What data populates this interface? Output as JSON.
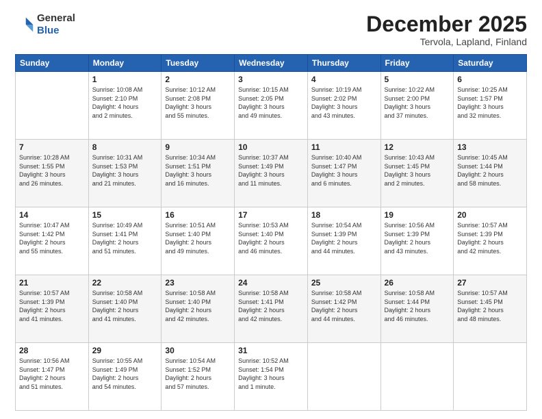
{
  "logo": {
    "general": "General",
    "blue": "Blue"
  },
  "header": {
    "month": "December 2025",
    "location": "Tervola, Lapland, Finland"
  },
  "weekdays": [
    "Sunday",
    "Monday",
    "Tuesday",
    "Wednesday",
    "Thursday",
    "Friday",
    "Saturday"
  ],
  "weeks": [
    [
      {
        "day": "",
        "info": ""
      },
      {
        "day": "1",
        "info": "Sunrise: 10:08 AM\nSunset: 2:10 PM\nDaylight: 4 hours\nand 2 minutes."
      },
      {
        "day": "2",
        "info": "Sunrise: 10:12 AM\nSunset: 2:08 PM\nDaylight: 3 hours\nand 55 minutes."
      },
      {
        "day": "3",
        "info": "Sunrise: 10:15 AM\nSunset: 2:05 PM\nDaylight: 3 hours\nand 49 minutes."
      },
      {
        "day": "4",
        "info": "Sunrise: 10:19 AM\nSunset: 2:02 PM\nDaylight: 3 hours\nand 43 minutes."
      },
      {
        "day": "5",
        "info": "Sunrise: 10:22 AM\nSunset: 2:00 PM\nDaylight: 3 hours\nand 37 minutes."
      },
      {
        "day": "6",
        "info": "Sunrise: 10:25 AM\nSunset: 1:57 PM\nDaylight: 3 hours\nand 32 minutes."
      }
    ],
    [
      {
        "day": "7",
        "info": "Sunrise: 10:28 AM\nSunset: 1:55 PM\nDaylight: 3 hours\nand 26 minutes."
      },
      {
        "day": "8",
        "info": "Sunrise: 10:31 AM\nSunset: 1:53 PM\nDaylight: 3 hours\nand 21 minutes."
      },
      {
        "day": "9",
        "info": "Sunrise: 10:34 AM\nSunset: 1:51 PM\nDaylight: 3 hours\nand 16 minutes."
      },
      {
        "day": "10",
        "info": "Sunrise: 10:37 AM\nSunset: 1:49 PM\nDaylight: 3 hours\nand 11 minutes."
      },
      {
        "day": "11",
        "info": "Sunrise: 10:40 AM\nSunset: 1:47 PM\nDaylight: 3 hours\nand 6 minutes."
      },
      {
        "day": "12",
        "info": "Sunrise: 10:43 AM\nSunset: 1:45 PM\nDaylight: 3 hours\nand 2 minutes."
      },
      {
        "day": "13",
        "info": "Sunrise: 10:45 AM\nSunset: 1:44 PM\nDaylight: 2 hours\nand 58 minutes."
      }
    ],
    [
      {
        "day": "14",
        "info": "Sunrise: 10:47 AM\nSunset: 1:42 PM\nDaylight: 2 hours\nand 55 minutes."
      },
      {
        "day": "15",
        "info": "Sunrise: 10:49 AM\nSunset: 1:41 PM\nDaylight: 2 hours\nand 51 minutes."
      },
      {
        "day": "16",
        "info": "Sunrise: 10:51 AM\nSunset: 1:40 PM\nDaylight: 2 hours\nand 49 minutes."
      },
      {
        "day": "17",
        "info": "Sunrise: 10:53 AM\nSunset: 1:40 PM\nDaylight: 2 hours\nand 46 minutes."
      },
      {
        "day": "18",
        "info": "Sunrise: 10:54 AM\nSunset: 1:39 PM\nDaylight: 2 hours\nand 44 minutes."
      },
      {
        "day": "19",
        "info": "Sunrise: 10:56 AM\nSunset: 1:39 PM\nDaylight: 2 hours\nand 43 minutes."
      },
      {
        "day": "20",
        "info": "Sunrise: 10:57 AM\nSunset: 1:39 PM\nDaylight: 2 hours\nand 42 minutes."
      }
    ],
    [
      {
        "day": "21",
        "info": "Sunrise: 10:57 AM\nSunset: 1:39 PM\nDaylight: 2 hours\nand 41 minutes."
      },
      {
        "day": "22",
        "info": "Sunrise: 10:58 AM\nSunset: 1:40 PM\nDaylight: 2 hours\nand 41 minutes."
      },
      {
        "day": "23",
        "info": "Sunrise: 10:58 AM\nSunset: 1:40 PM\nDaylight: 2 hours\nand 42 minutes."
      },
      {
        "day": "24",
        "info": "Sunrise: 10:58 AM\nSunset: 1:41 PM\nDaylight: 2 hours\nand 42 minutes."
      },
      {
        "day": "25",
        "info": "Sunrise: 10:58 AM\nSunset: 1:42 PM\nDaylight: 2 hours\nand 44 minutes."
      },
      {
        "day": "26",
        "info": "Sunrise: 10:58 AM\nSunset: 1:44 PM\nDaylight: 2 hours\nand 46 minutes."
      },
      {
        "day": "27",
        "info": "Sunrise: 10:57 AM\nSunset: 1:45 PM\nDaylight: 2 hours\nand 48 minutes."
      }
    ],
    [
      {
        "day": "28",
        "info": "Sunrise: 10:56 AM\nSunset: 1:47 PM\nDaylight: 2 hours\nand 51 minutes."
      },
      {
        "day": "29",
        "info": "Sunrise: 10:55 AM\nSunset: 1:49 PM\nDaylight: 2 hours\nand 54 minutes."
      },
      {
        "day": "30",
        "info": "Sunrise: 10:54 AM\nSunset: 1:52 PM\nDaylight: 2 hours\nand 57 minutes."
      },
      {
        "day": "31",
        "info": "Sunrise: 10:52 AM\nSunset: 1:54 PM\nDaylight: 3 hours\nand 1 minute."
      },
      {
        "day": "",
        "info": ""
      },
      {
        "day": "",
        "info": ""
      },
      {
        "day": "",
        "info": ""
      }
    ]
  ]
}
